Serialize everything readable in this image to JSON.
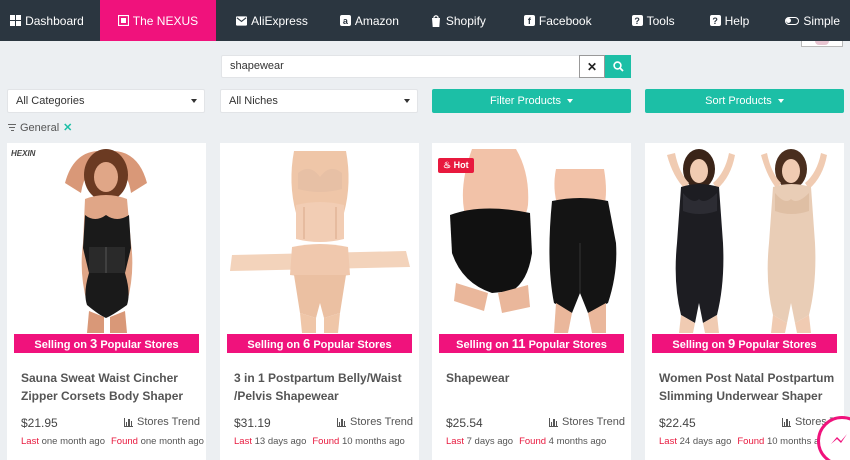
{
  "nav": {
    "items": [
      {
        "label": "Dashboard",
        "icon": "grid-icon",
        "active": false
      },
      {
        "label": "The NEXUS",
        "icon": "nexus-icon",
        "active": true
      },
      {
        "label": "AliExpress",
        "icon": "mail-icon",
        "active": false
      },
      {
        "label": "Amazon",
        "icon": "amazon-icon",
        "active": false
      },
      {
        "label": "Shopify",
        "icon": "shopify-bag-icon",
        "active": false
      },
      {
        "label": "Facebook",
        "icon": "facebook-icon",
        "active": false
      },
      {
        "label": "Tools",
        "icon": "question-icon",
        "active": false
      },
      {
        "label": "Help",
        "icon": "question-icon",
        "active": false
      },
      {
        "label": "Simple",
        "icon": "toggle-icon",
        "active": false
      }
    ]
  },
  "search": {
    "value": "shapewear"
  },
  "filters": {
    "category": "All Categories",
    "niche": "All Niches",
    "filter_label": "Filter Products",
    "sort_label": "Sort Products",
    "active_tag": "General"
  },
  "colors": {
    "accent": "#f0127c",
    "teal": "#1cbfa6",
    "nav": "#2b3640",
    "hot": "#e8193e"
  },
  "products": [
    {
      "banner_pre": "Selling on ",
      "banner_num": "3",
      "banner_post": " Popular Stores",
      "title": "Sauna Sweat Waist Cincher Zipper Corsets Body Shaper",
      "price": "$21.95",
      "trend": "Stores Trend",
      "last_label": "Last",
      "last": "one month ago",
      "found_label": "Found",
      "found": "one month ago",
      "badge": "",
      "brand": "HEXIN"
    },
    {
      "banner_pre": "Selling on ",
      "banner_num": "6",
      "banner_post": " Popular Stores",
      "title": "3 in 1 Postpartum Belly/Waist /Pelvis Shapewear",
      "price": "$31.19",
      "trend": "Stores Trend",
      "last_label": "Last",
      "last": "13 days ago",
      "found_label": "Found",
      "found": "10 months ago",
      "badge": "",
      "brand": ""
    },
    {
      "banner_pre": "Selling on ",
      "banner_num": "11",
      "banner_post": " Popular Stores",
      "title": "Shapewear",
      "price": "$25.54",
      "trend": "Stores Trend",
      "last_label": "Last",
      "last": "7 days ago",
      "found_label": "Found",
      "found": "4 months ago",
      "badge": "Hot",
      "brand": ""
    },
    {
      "banner_pre": "Selling on ",
      "banner_num": "9",
      "banner_post": " Popular Stores",
      "title": "Women Post Natal Postpartum Slimming Underwear Shaper",
      "price": "$22.45",
      "trend": "Stores Trend",
      "last_label": "Last",
      "last": "24 days ago",
      "found_label": "Found",
      "found": "10 months ago",
      "badge": "",
      "brand": ""
    }
  ]
}
